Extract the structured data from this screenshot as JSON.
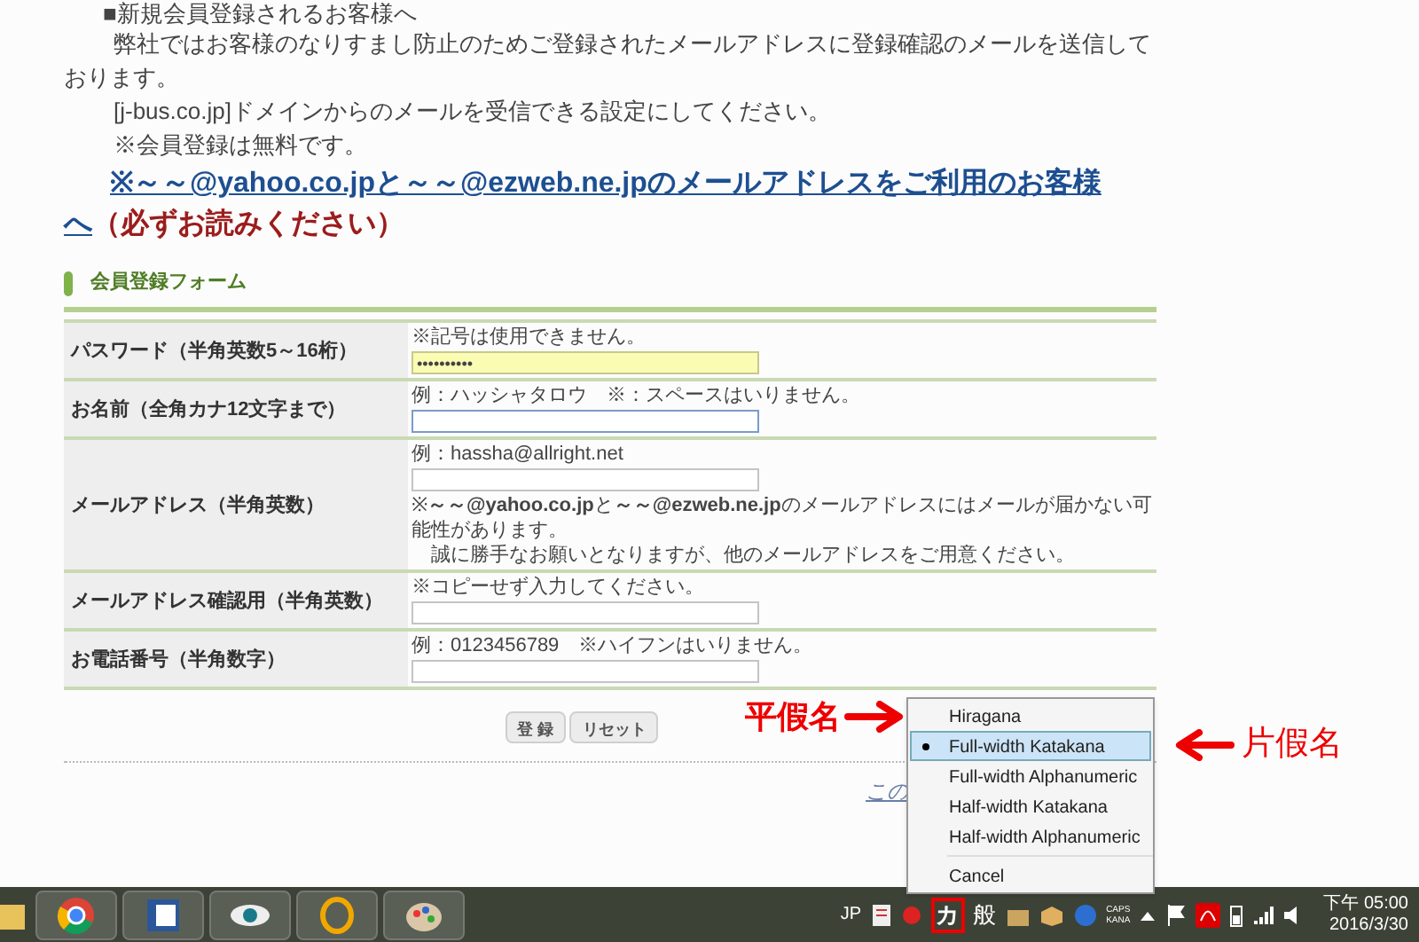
{
  "intro": {
    "heading": "■新規会員登録されるお客様へ",
    "paragraphs": [
      {
        "text": "弊社ではお客様のなりすまし防止のためご登録されたメールアドレスに登録確認のメールを送信しております。"
      },
      {
        "text": "[j-bus.co.jp]ドメインからのメールを受信できる設定にしてください。"
      },
      {
        "text": "※会員登録は無料です。"
      }
    ]
  },
  "notice": {
    "link_line_1": "※～～@yahoo.co.jpと～～@ezweb.ne.jpのメールアドレスをご利用のお客様",
    "link_line_2": "へ",
    "note": "（必ずお読みください）"
  },
  "form": {
    "title": "会員登録フォーム",
    "rows": [
      {
        "label": "パスワード（半角英数5～16桁）",
        "hint": "※記号は使用できません。",
        "input": {
          "value": "••••••••••",
          "autofilled": true,
          "focused": false
        },
        "notes": []
      },
      {
        "label": "お名前（全角カナ12文字まで）",
        "hint": "例：ハッシャタロウ　※：スペースはいりません。",
        "input": {
          "autofilled": false,
          "focused": true
        },
        "notes": []
      },
      {
        "label": "メールアドレス（半角英数）",
        "hint": "例：hassha@allright.net",
        "input": {
          "autofilled": false,
          "focused": false
        },
        "notes": [
          "※**～～@yahoo.co.jp**と**～～@ezweb.ne.jp**のメールアドレスにはメールが届かない可能性があります。",
          "　誠に勝手なお願いとなりますが、他のメールアドレスをご用意ください。"
        ]
      },
      {
        "label": "メールアドレス確認用（半角英数）",
        "hint": "※コピーせず入力してください。",
        "input": {
          "autofilled": false,
          "focused": false
        },
        "notes": []
      },
      {
        "label": "お電話番号（半角数字）",
        "hint": "例：0123456789　※ハイフンはいりません。",
        "input": {
          "autofilled": false,
          "focused": false
        },
        "notes": []
      }
    ],
    "buttons": [
      "登 録",
      "リセット"
    ]
  },
  "footer_link": "この",
  "ime_menu": {
    "items": [
      {
        "label": "Hiragana",
        "selected": false,
        "kind": "option"
      },
      {
        "label": "Full-width Katakana",
        "selected": true,
        "kind": "option"
      },
      {
        "label": "Full-width Alphanumeric",
        "selected": false,
        "kind": "option"
      },
      {
        "label": "Half-width Katakana",
        "selected": false,
        "kind": "option"
      },
      {
        "label": "Half-width Alphanumeric",
        "selected": false,
        "kind": "option"
      },
      {
        "label": "Cancel",
        "selected": false,
        "kind": "command"
      }
    ]
  },
  "annotations": [
    {
      "text": "平假名",
      "kind": "arrow_after"
    },
    {
      "text": "片假名",
      "kind": "arrow_before"
    }
  ],
  "taskbar": {
    "language": "JP",
    "ime_mode": "カ",
    "ime_input": "般",
    "caps": "CAPS",
    "kana": "KANA",
    "time": "下午 05:00",
    "date": "2016/3/30"
  }
}
